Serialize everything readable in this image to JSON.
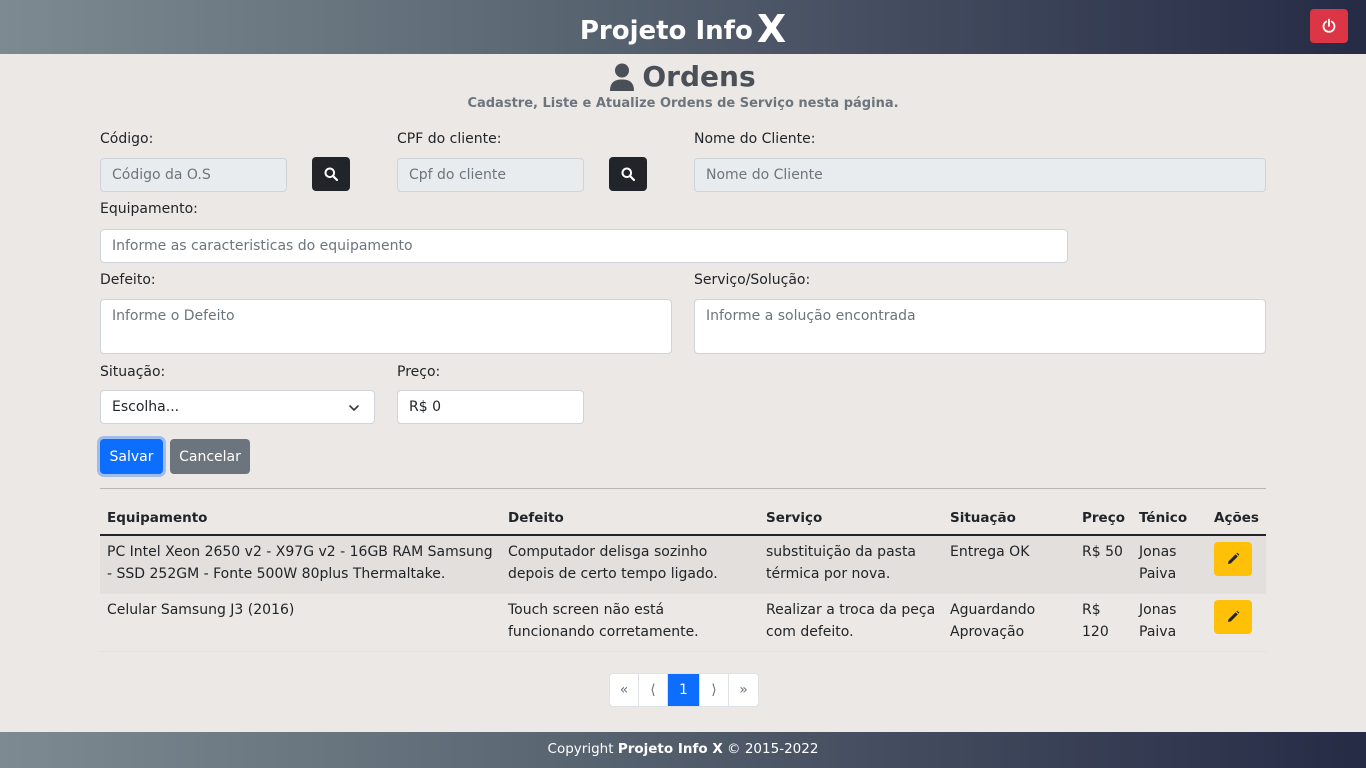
{
  "header": {
    "brand": "Projeto Info",
    "brand_mark": "X",
    "logout_icon": "power-icon"
  },
  "page": {
    "title": "Ordens",
    "subtitle": "Cadastre, Liste e Atualize Ordens de Serviço nesta página."
  },
  "form": {
    "codigo_label": "Código:",
    "codigo_placeholder": "Código da O.S",
    "cpf_label": "CPF do cliente:",
    "cpf_placeholder": "Cpf do cliente",
    "nome_label": "Nome do Cliente:",
    "nome_placeholder": "Nome do Cliente",
    "equip_label": "Equipamento:",
    "equip_placeholder": "Informe as caracteristicas do equipamento",
    "defeito_label": "Defeito:",
    "defeito_placeholder": "Informe o Defeito",
    "servico_label": "Serviço/Solução:",
    "servico_placeholder": "Informe a solução encontrada",
    "situacao_label": "Situação:",
    "situacao_value": "Escolha...",
    "preco_label": "Preço:",
    "preco_value": "R$ 0",
    "save_label": "Salvar",
    "cancel_label": "Cancelar"
  },
  "table": {
    "headers": [
      "Equipamento",
      "Defeito",
      "Serviço",
      "Situação",
      "Preço",
      "Ténico",
      "Ações"
    ],
    "rows": [
      {
        "equipamento": "PC Intel Xeon 2650 v2 - X97G v2 - 16GB RAM Samsung - SSD 252GM - Fonte 500W 80plus Thermaltake.",
        "defeito": "Computador delisga sozinho depois de certo tempo ligado.",
        "servico": "substituição da pasta térmica por nova.",
        "situacao": "Entrega OK",
        "preco": "R$ 50",
        "tecnico": "Jonas Paiva"
      },
      {
        "equipamento": "Celular Samsung J3 (2016)",
        "defeito": "Touch screen não está funcionando corretamente.",
        "servico": "Realizar a troca da peça com defeito.",
        "situacao": "Aguardando Aprovação",
        "preco": "R$ 120",
        "tecnico": "Jonas Paiva"
      }
    ]
  },
  "pagination": {
    "first": "«",
    "prev": "⟨",
    "current": "1",
    "next": "⟩",
    "last": "»"
  },
  "footer": {
    "prefix": "Copyright",
    "brand": "Projeto Info X",
    "suffix": "© 2015-2022"
  },
  "colors": {
    "danger": "#dc3545",
    "primary": "#0d6efd",
    "warning": "#ffc107",
    "dark": "#212529"
  }
}
